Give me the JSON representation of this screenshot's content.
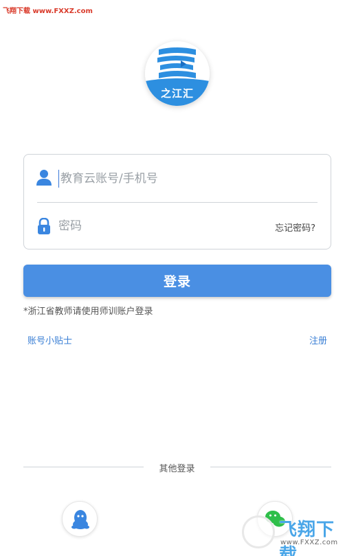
{
  "watermark": {
    "top_text": "飞翔下载 www.FXXZ.com",
    "brand_text": "飞翔下载",
    "url_text": "www.FXXZ.com"
  },
  "logo": {
    "text": "之江汇"
  },
  "form": {
    "account_placeholder": "教育云账号/手机号",
    "password_placeholder": "密码",
    "forgot_label": "忘记密码?"
  },
  "login_button": {
    "label": "登录"
  },
  "notice": "*浙江省教师请使用师训账户登录",
  "links": {
    "tips": "账号小贴士",
    "register": "注册"
  },
  "other_login": {
    "label": "其他登录"
  },
  "colors": {
    "primary": "#4a8fe3",
    "link": "#3a7fd5",
    "icon": "#3a86e0",
    "watermark_red": "#d93a2a"
  }
}
